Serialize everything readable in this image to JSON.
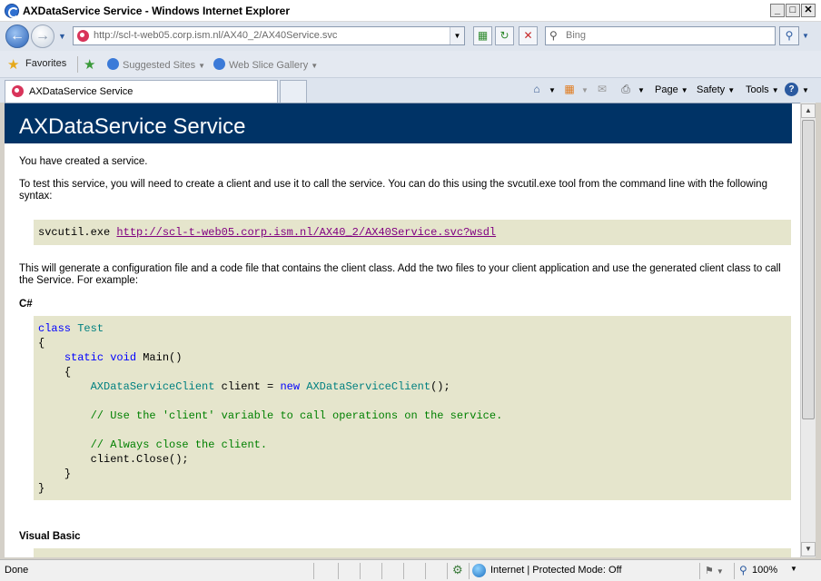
{
  "window": {
    "title": "AXDataService Service - Windows Internet Explorer",
    "min_label": "_",
    "max_label": "□",
    "close_label": "✕"
  },
  "address_bar": {
    "url": "http://scl-t-web05.corp.ism.nl/AX40_2/AX40Service.svc",
    "search_placeholder": "Bing"
  },
  "favorites_bar": {
    "favorites_label": "Favorites",
    "items": [
      {
        "label": "Suggested Sites"
      },
      {
        "label": "Web Slice Gallery"
      }
    ]
  },
  "tabs": [
    {
      "label": "AXDataService Service"
    }
  ],
  "command_bar": {
    "page_label": "Page",
    "safety_label": "Safety",
    "tools_label": "Tools"
  },
  "page": {
    "heading": "AXDataService Service",
    "intro": "You have created a service.",
    "instructions": "To test this service, you will need to create a client and use it to call the service. You can do this using the svcutil.exe tool from the command line with the following syntax:",
    "svcutil_cmd": "svcutil.exe ",
    "wsdl_link": "http://scl-t-web05.corp.ism.nl/AX40_2/AX40Service.svc?wsdl",
    "generate_text": "This will generate a configuration file and a code file that contains the client class. Add the two files to your client application and use the generated client class to call the Service. For example:",
    "csharp_heading": "C#",
    "vb_heading": "Visual Basic",
    "csharp_code": {
      "class_kw": "class",
      "class_name": "Test",
      "open_brace": "{",
      "static_void": "static void",
      "main_sig": " Main()",
      "inner_open": "{",
      "client_type": "AXDataServiceClient",
      "client_decl": " client = ",
      "new_kw": "new",
      "client_ctor": "AXDataServiceClient",
      "ctor_tail": "();",
      "comment1": "// Use the 'client' variable to call operations on the service.",
      "comment2": "// Always close the client.",
      "close_call": "client.Close();",
      "inner_close": "}",
      "close_brace": "}"
    }
  },
  "status_bar": {
    "status": "Done",
    "zone": "Internet | Protected Mode: Off",
    "zoom": "100%"
  }
}
